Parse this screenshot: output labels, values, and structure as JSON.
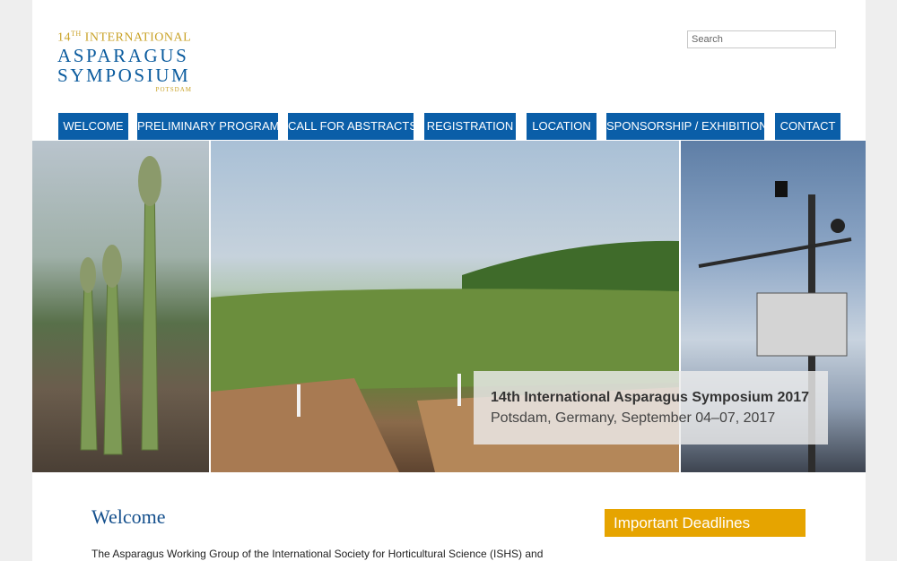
{
  "logo": {
    "line1_number": "14",
    "line1_sup": "TH",
    "line1_text": "INTERNATIONAL",
    "line2": "ASPARAGUS",
    "line3": "SYMPOSIUM",
    "line4": "POTSDAM"
  },
  "search": {
    "placeholder": "Search"
  },
  "nav": {
    "items": [
      {
        "label": "WELCOME"
      },
      {
        "label": "PRELIMINARY PROGRAM"
      },
      {
        "label": "CALL FOR ABSTRACTS"
      },
      {
        "label": "REGISTRATION"
      },
      {
        "label": "LOCATION"
      },
      {
        "label": "SPONSORSHIP / EXHIBITION"
      },
      {
        "label": "CONTACT"
      }
    ]
  },
  "hero": {
    "caption_title": "14th International Asparagus Symposium 2017",
    "caption_subtitle": "Potsdam, Germany, September 04–07, 2017"
  },
  "content": {
    "welcome_heading": "Welcome",
    "intro_text": "The Asparagus Working Group of the International Society for Horticultural Science (ISHS) and"
  },
  "sidebar": {
    "deadlines_heading": "Important Deadlines"
  },
  "colors": {
    "nav_blue": "#0a5ea8",
    "accent_gold": "#e6a400",
    "heading_blue": "#15508d"
  }
}
